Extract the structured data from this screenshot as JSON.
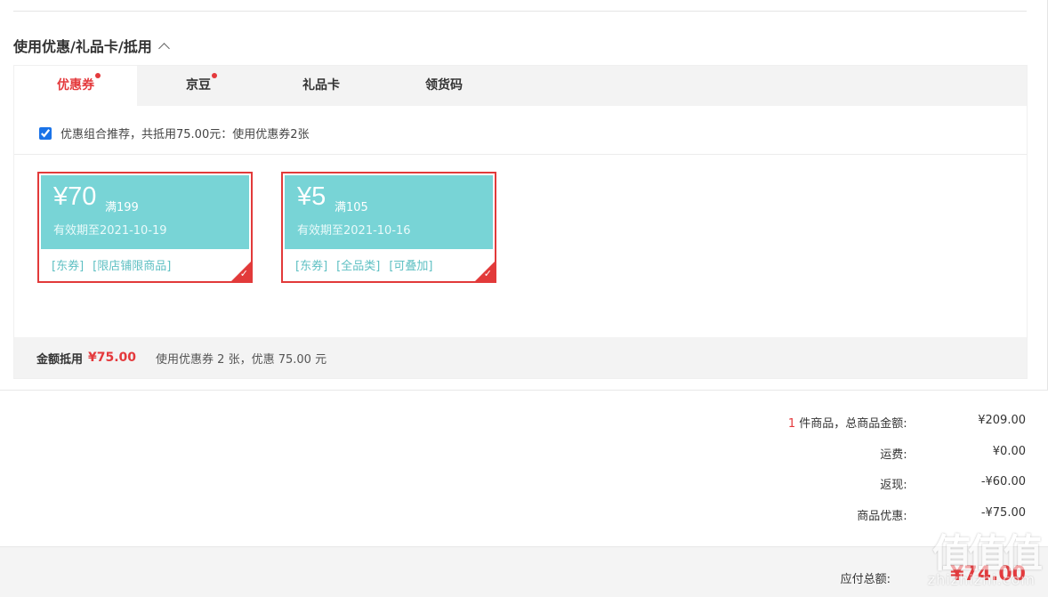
{
  "section_title": "使用优惠/礼品卡/抵用",
  "tabs": [
    {
      "label": "优惠券",
      "dot": true,
      "active": true
    },
    {
      "label": "京豆",
      "dot": true,
      "active": false
    },
    {
      "label": "礼品卡",
      "dot": false,
      "active": false
    },
    {
      "label": "领货码",
      "dot": false,
      "active": false
    }
  ],
  "recommend": {
    "checked": true,
    "text": "优惠组合推荐，共抵用75.00元：使用优惠券2张"
  },
  "coupons": [
    {
      "amount": "¥70",
      "condition": "满199",
      "expire": "有效期至2021-10-19",
      "tags": [
        "[东券]",
        "[限店铺限商品]"
      ],
      "selected": true
    },
    {
      "amount": "¥5",
      "condition": "满105",
      "expire": "有效期至2021-10-16",
      "tags": [
        "[东券]",
        "[全品类]",
        "[可叠加]"
      ],
      "selected": true
    }
  ],
  "summary": {
    "label": "金额抵用",
    "amount": "¥75.00",
    "desc": "使用优惠券 2 张，优惠 75.00 元"
  },
  "totals": {
    "items_count": "1",
    "items_label": " 件商品，总商品金额:",
    "items_value": "¥209.00",
    "shipping_label": "运费:",
    "shipping_value": "¥0.00",
    "rebate_label": "返现:",
    "rebate_value": "-¥60.00",
    "discount_label": "商品优惠:",
    "discount_value": "-¥75.00"
  },
  "payable": {
    "label": "应付总额:",
    "value": "¥74.00"
  },
  "watermark": {
    "big": "值值值",
    "small": "zhizhizhi.com"
  },
  "colors": {
    "accent_red": "#e4393c",
    "coupon_teal": "#78d4d6",
    "coupon_border": "#e23a3a"
  }
}
